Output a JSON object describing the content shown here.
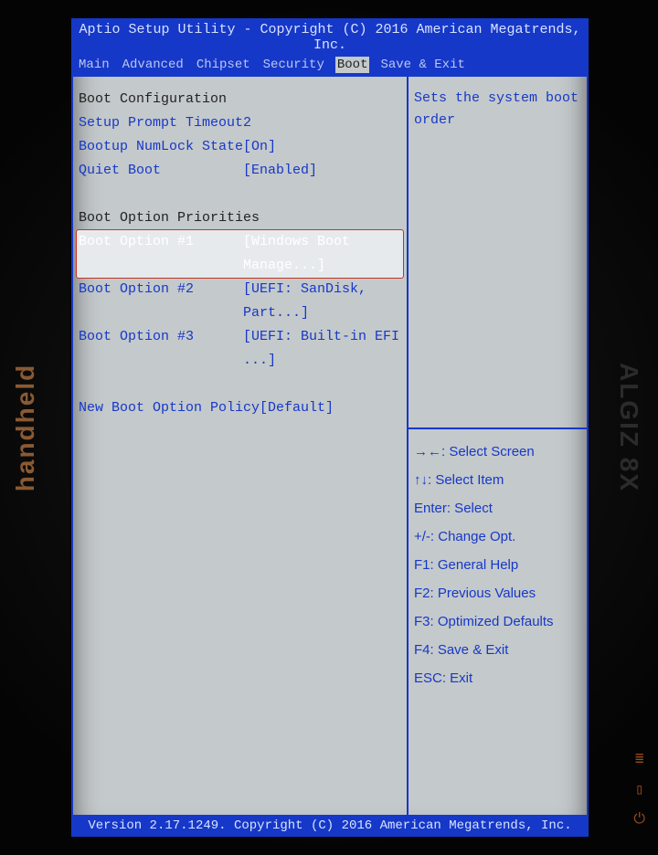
{
  "bezel": {
    "left": "handheld",
    "right": "ALGIZ 8X"
  },
  "header": {
    "title": "Aptio Setup Utility - Copyright (C) 2016 American Megatrends, Inc."
  },
  "menu": {
    "tabs": [
      {
        "label": "Main"
      },
      {
        "label": "Advanced"
      },
      {
        "label": "Chipset"
      },
      {
        "label": "Security"
      },
      {
        "label": "Boot",
        "active": true
      },
      {
        "label": "Save & Exit"
      }
    ]
  },
  "left": {
    "section1_title": "Boot Configuration",
    "rows1": [
      {
        "label": "Setup Prompt Timeout",
        "value": "2"
      },
      {
        "label": "Bootup NumLock State",
        "value": "[On]"
      },
      {
        "label": "Quiet Boot",
        "value": "[Enabled]"
      }
    ],
    "section2_title": "Boot Option Priorities",
    "rows2": [
      {
        "label": "Boot Option #1",
        "value": "[Windows Boot Manage...]",
        "selected": true
      },
      {
        "label": "Boot Option #2",
        "value": "[UEFI: SanDisk, Part...]"
      },
      {
        "label": "Boot Option #3",
        "value": "[UEFI: Built-in EFI ...]"
      }
    ],
    "rows3": [
      {
        "label": "New Boot Option Policy",
        "value": "[Default]"
      }
    ]
  },
  "right": {
    "help": "Sets the system boot order",
    "keys": [
      "→←: Select Screen",
      "↑↓: Select Item",
      "Enter: Select",
      "+/-: Change Opt.",
      "F1: General Help",
      "F2: Previous Values",
      "F3: Optimized Defaults",
      "F4: Save & Exit",
      "ESC: Exit"
    ]
  },
  "footer": {
    "text": "Version 2.17.1249. Copyright (C) 2016 American Megatrends, Inc."
  }
}
